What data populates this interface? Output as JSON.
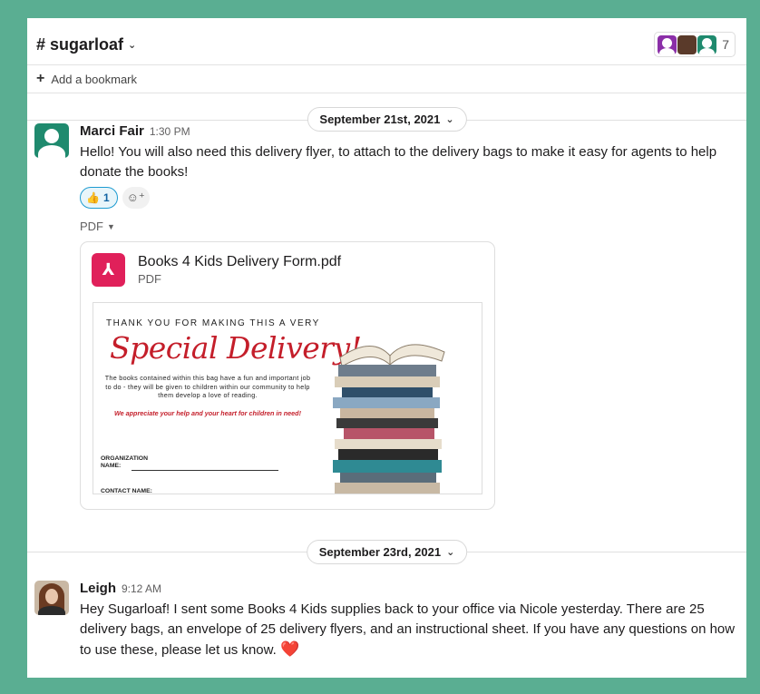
{
  "channel": {
    "name": "# sugarloaf",
    "member_count": "7"
  },
  "bookmarks": {
    "add_label": "Add a bookmark"
  },
  "day_separators": [
    {
      "label": "September 21st, 2021"
    },
    {
      "label": "September 23rd, 2021"
    }
  ],
  "messages": [
    {
      "author": "Marci Fair",
      "time": "1:30 PM",
      "text": "Hello! You will also need this delivery flyer, to attach to the delivery bags to make it easy for agents to help donate the books!",
      "reaction": {
        "emoji": "👍",
        "count": "1"
      },
      "attachment_toggle": "PDF",
      "file": {
        "name": "Books 4 Kids Delivery Form.pdf",
        "type": "PDF",
        "preview": {
          "thanks": "THANK YOU FOR MAKING THIS A VERY",
          "title": "Special Delivery!",
          "body": "The books contained within this bag have a fun and important job to do - they will be given to children within our community to help them develop a love of reading.",
          "red_text": "We appreciate your help and your heart for children in need!",
          "org_label": "ORGANIZATION NAME:",
          "contact_label": "CONTACT NAME:"
        }
      }
    },
    {
      "author": "Leigh",
      "time": "9:12 AM",
      "text": "Hey Sugarloaf! I sent some Books 4 Kids supplies back to your office via Nicole yesterday. There are 25 delivery bags, an envelope of 25 delivery flyers, and an instructional sheet. If you have any questions on how to use these, please let us know.",
      "emoji": "❤️"
    }
  ]
}
